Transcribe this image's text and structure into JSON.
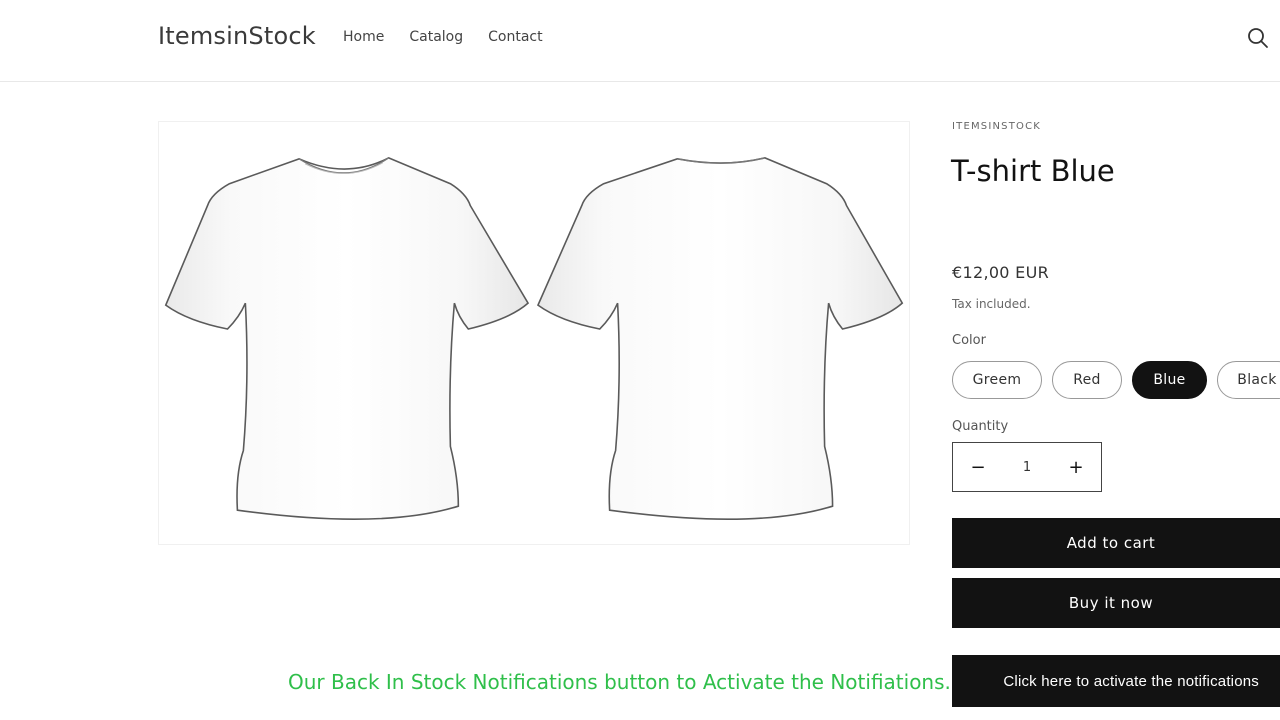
{
  "header": {
    "logo": "ItemsinStock",
    "nav": [
      "Home",
      "Catalog",
      "Contact"
    ],
    "search_icon": "search-icon"
  },
  "product": {
    "vendor": "ITEMSINSTOCK",
    "title": "T-shirt Blue",
    "price": "€12,00 EUR",
    "tax_note": "Tax included.",
    "color_label": "Color",
    "colors": [
      "Greem",
      "Red",
      "Blue",
      "Black"
    ],
    "selected_color": "Blue",
    "quantity_label": "Quantity",
    "quantity": "1",
    "minus": "−",
    "plus": "+",
    "add_to_cart": "Add to cart",
    "buy_now": "Buy it now",
    "notify": "Click here to activate the notifications"
  },
  "caption": "Our Back In Stock Notifications button to Activate the Notifiations.",
  "colors": {
    "accent_dark": "#121212",
    "caption_green": "#2fbf4a"
  }
}
